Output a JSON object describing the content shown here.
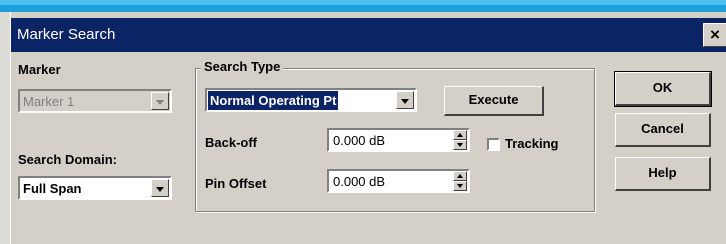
{
  "window": {
    "title": "Marker Search",
    "close_label": "×"
  },
  "marker": {
    "label": "Marker",
    "value": "Marker 1"
  },
  "search_domain": {
    "label": "Search Domain:",
    "value": "Full Span"
  },
  "search_type": {
    "group_label": "Search Type",
    "value": "Normal Operating Pt",
    "execute_label": "Execute",
    "backoff_label": "Back-off",
    "backoff_value": "0.000 dB",
    "tracking_label": "Tracking",
    "pin_offset_label": "Pin Offset",
    "pin_offset_value": "0.000 dB"
  },
  "buttons": {
    "ok": "OK",
    "cancel": "Cancel",
    "help": "Help"
  }
}
